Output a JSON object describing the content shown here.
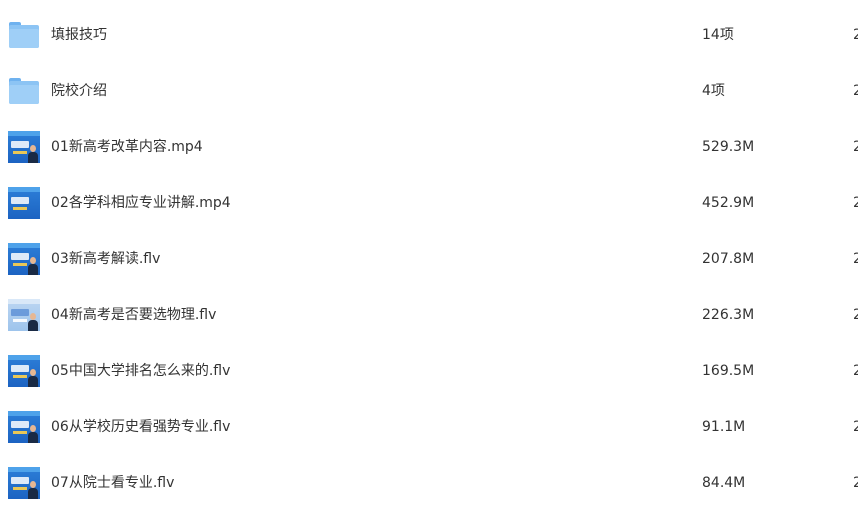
{
  "files": [
    {
      "name": "填报技巧",
      "size": "14项",
      "type": "folder",
      "icon": "folder-icon",
      "trailing": "2"
    },
    {
      "name": "院校介绍",
      "size": "4项",
      "type": "folder",
      "icon": "folder-icon",
      "trailing": "2"
    },
    {
      "name": "01新高考改革内容.mp4",
      "size": "529.3M",
      "type": "video",
      "icon": "video-thumbnail-icon",
      "trailing": "2"
    },
    {
      "name": "02各学科相应专业讲解.mp4",
      "size": "452.9M",
      "type": "video",
      "icon": "video-thumbnail-icon",
      "trailing": "2"
    },
    {
      "name": "03新高考解读.flv",
      "size": "207.8M",
      "type": "video",
      "icon": "video-thumbnail-icon",
      "trailing": "2"
    },
    {
      "name": "04新高考是否要选物理.flv",
      "size": "226.3M",
      "type": "video",
      "icon": "video-thumbnail-icon",
      "trailing": "2"
    },
    {
      "name": "05中国大学排名怎么来的.flv",
      "size": "169.5M",
      "type": "video",
      "icon": "video-thumbnail-icon",
      "trailing": "2"
    },
    {
      "name": "06从学校历史看强势专业.flv",
      "size": "91.1M",
      "type": "video",
      "icon": "video-thumbnail-icon",
      "trailing": "2"
    },
    {
      "name": "07从院士看专业.flv",
      "size": "84.4M",
      "type": "video",
      "icon": "video-thumbnail-icon",
      "trailing": "2"
    }
  ],
  "colors": {
    "folder": "#8cc4f4",
    "video_thumb": "#2d7fd8",
    "text": "#333333",
    "background": "#ffffff"
  }
}
